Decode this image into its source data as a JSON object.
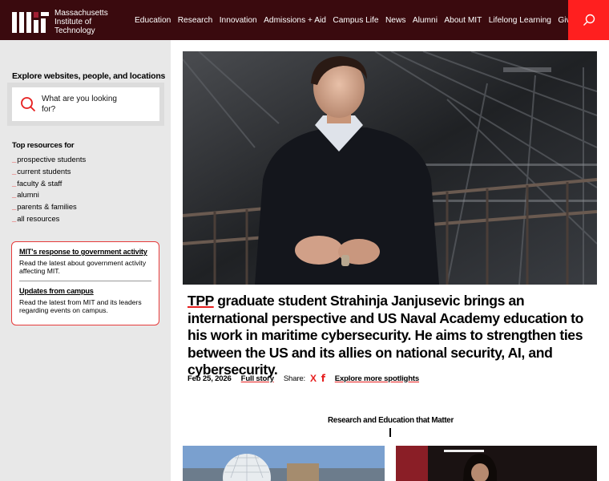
{
  "brand": {
    "name_lines": [
      "Massachusetts",
      "Institute of",
      "Technology"
    ]
  },
  "nav": {
    "items": [
      "Education",
      "Research",
      "Innovation",
      "Admissions + Aid",
      "Campus Life",
      "News",
      "Alumni",
      "About MIT",
      "Lifelong Learning",
      "Give"
    ]
  },
  "sidebar": {
    "explore_title": "Explore websites, people, and locations",
    "search_placeholder": "What are you looking for?",
    "top_resources_title": "Top resources for",
    "resources": [
      "prospective students",
      "current students",
      "faculty & staff",
      "alumni",
      "parents & families",
      "all resources"
    ],
    "alerts": [
      {
        "title": "MIT's response to government activity",
        "body": "Read the latest about government activity affecting MIT."
      },
      {
        "title": "Updates from campus",
        "body": "Read the latest from MIT and its leaders regarding events on campus."
      }
    ]
  },
  "spotlight": {
    "tpp": "TPP",
    "headline_rest": " graduate student Strahinja Janjusevic brings an international perspective and US Naval Academy education to his work in maritime cybersecurity. He aims to strengthen ties between the US and its allies on national security, AI, and cybersecurity.",
    "date": "Feb 25, 2026",
    "full_story": "Full story",
    "share_label": "Share:",
    "share_x": "X",
    "share_f": "f",
    "explore_more": "Explore more spotlights"
  },
  "section": {
    "title": "Research and Education that Matter"
  },
  "colors": {
    "header_bg": "#3a0a0e",
    "accent_red": "#ff1f1f"
  }
}
